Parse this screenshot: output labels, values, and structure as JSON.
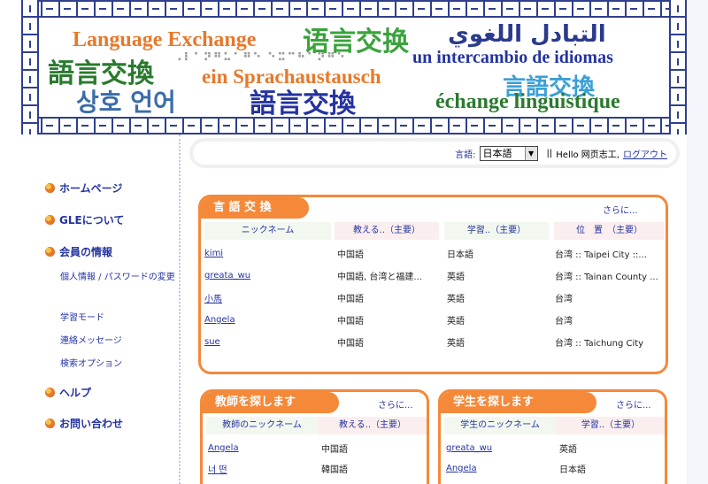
{
  "banner": {
    "language_exchange": "Language Exchange",
    "zh_simplified": "语言交换",
    "arabic": "التبادل اللغوي",
    "zh_traditional_bold": "語言交換",
    "braille": "⠠⠇⠁⠝⠛⠥⠁⠛⠑ ⠑⠭⠉⠓⠁⠝⠛⠑",
    "spanish": "un intercambio de idiomas",
    "german": "ein Sprachaustausch",
    "zh_traditional_blue": "言語交換",
    "korean": "상호 언어",
    "seal_script": "語言交換",
    "french": "échange linguistique"
  },
  "sidebar": {
    "items": [
      {
        "label": "ホームページ",
        "type": "main",
        "icon": "flower-bullet-icon"
      },
      {
        "label": "GLEについて",
        "type": "main",
        "icon": "flower-bullet-icon"
      },
      {
        "label": "会員の情報",
        "type": "main",
        "icon": "flower-bullet-icon"
      },
      {
        "label": "個人情報 / パスワードの変更",
        "type": "sub"
      },
      {
        "label": "学習モード",
        "type": "sub"
      },
      {
        "label": "連絡メッセージ",
        "type": "sub"
      },
      {
        "label": "検索オプション",
        "type": "sub"
      },
      {
        "label": "ヘルプ",
        "type": "main",
        "icon": "flower-bullet-icon"
      },
      {
        "label": "お問い合わせ",
        "type": "main",
        "icon": "flower-bullet-icon"
      }
    ]
  },
  "toolbar": {
    "lang_label": "言語:",
    "lang_value": "日本語",
    "separator": "||",
    "hello": "Hello 网页志工,",
    "logout": "ログアウト"
  },
  "exchange": {
    "title": "言 語 交 換",
    "more": "さらに...",
    "headers": [
      "ニックネーム",
      "教える..（主要）",
      "学習..（主要）",
      "位　置　（主要）"
    ],
    "rows": [
      {
        "nick": "kimi",
        "teach": "中国語",
        "learn": "日本語",
        "location": "台湾 :: Taipei City ::..."
      },
      {
        "nick": "greata_wu",
        "teach": "中国語, 台湾と福建...",
        "learn": "英語",
        "location": "台湾 :: Tainan County ..."
      },
      {
        "nick": "小馬",
        "teach": "中国語",
        "learn": "英語",
        "location": "台湾"
      },
      {
        "nick": "Angela",
        "teach": "中国語",
        "learn": "英語",
        "location": "台湾"
      },
      {
        "nick": "sue",
        "teach": "中国語",
        "learn": "英語",
        "location": "台湾 :: Taichung City"
      }
    ]
  },
  "teachers": {
    "title": "教師を探します",
    "more": "さらに...",
    "headers": [
      "教師のニックネーム",
      "教える..（主要）"
    ],
    "rows": [
      {
        "nick": "Angela",
        "teach": "中国語"
      },
      {
        "nick": "너 떤",
        "teach": "韓国語"
      }
    ]
  },
  "students": {
    "title": "学生を探します",
    "more": "さらに...",
    "headers": [
      "学生のニックネーム",
      "学習..（主要）"
    ],
    "rows": [
      {
        "nick": "greata_wu",
        "learn": "英語"
      },
      {
        "nick": "Angela",
        "learn": "日本語"
      }
    ]
  },
  "colors": {
    "accent_orange": "#f4893a",
    "nav_blue": "#2433a0",
    "border_blue": "#2f3f8f"
  }
}
